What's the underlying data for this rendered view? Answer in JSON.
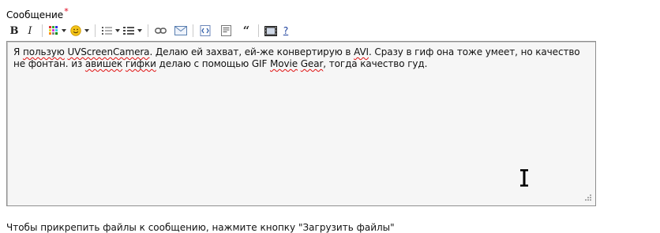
{
  "form": {
    "message_label": "Сообщение",
    "required_mark": "*"
  },
  "toolbar": {
    "bold_label": "B",
    "italic_label": "I",
    "quote_label": "“",
    "help_label": "?",
    "icons": [
      "bold-icon",
      "italic-icon",
      "color-palette-icon",
      "smiley-icon",
      "bullet-list-icon",
      "numbered-list-icon",
      "link-icon",
      "email-icon",
      "code-icon",
      "document-icon",
      "quote-icon",
      "video-icon",
      "help-icon"
    ]
  },
  "editor": {
    "segments": [
      {
        "text": "Я ",
        "spell": false
      },
      {
        "text": "пользую",
        "spell": true
      },
      {
        "text": " ",
        "spell": false
      },
      {
        "text": "UVScreenCamera",
        "spell": true
      },
      {
        "text": ". Делаю ей захват, ей-же конвертирую в ",
        "spell": false
      },
      {
        "text": "AVI",
        "spell": true
      },
      {
        "text": ". Сразу в гиф она тоже умеет, но качество не фонтан. из ",
        "spell": false
      },
      {
        "text": "авишек",
        "spell": true
      },
      {
        "text": " ",
        "spell": false
      },
      {
        "text": "гифки",
        "spell": true
      },
      {
        "text": " делаю с помощью GIF ",
        "spell": false
      },
      {
        "text": "Movie",
        "spell": true
      },
      {
        "text": " ",
        "spell": false
      },
      {
        "text": "Gear",
        "spell": true
      },
      {
        "text": ", тогда качество гуд.",
        "spell": false
      }
    ]
  },
  "footer": {
    "note": "Чтобы прикрепить файлы к сообщению, нажмите кнопку \"Загрузить файлы\""
  },
  "colors": {
    "required": "#e0001a",
    "spellcheck": "#e01010",
    "editor_bg": "#f6f6f6"
  }
}
